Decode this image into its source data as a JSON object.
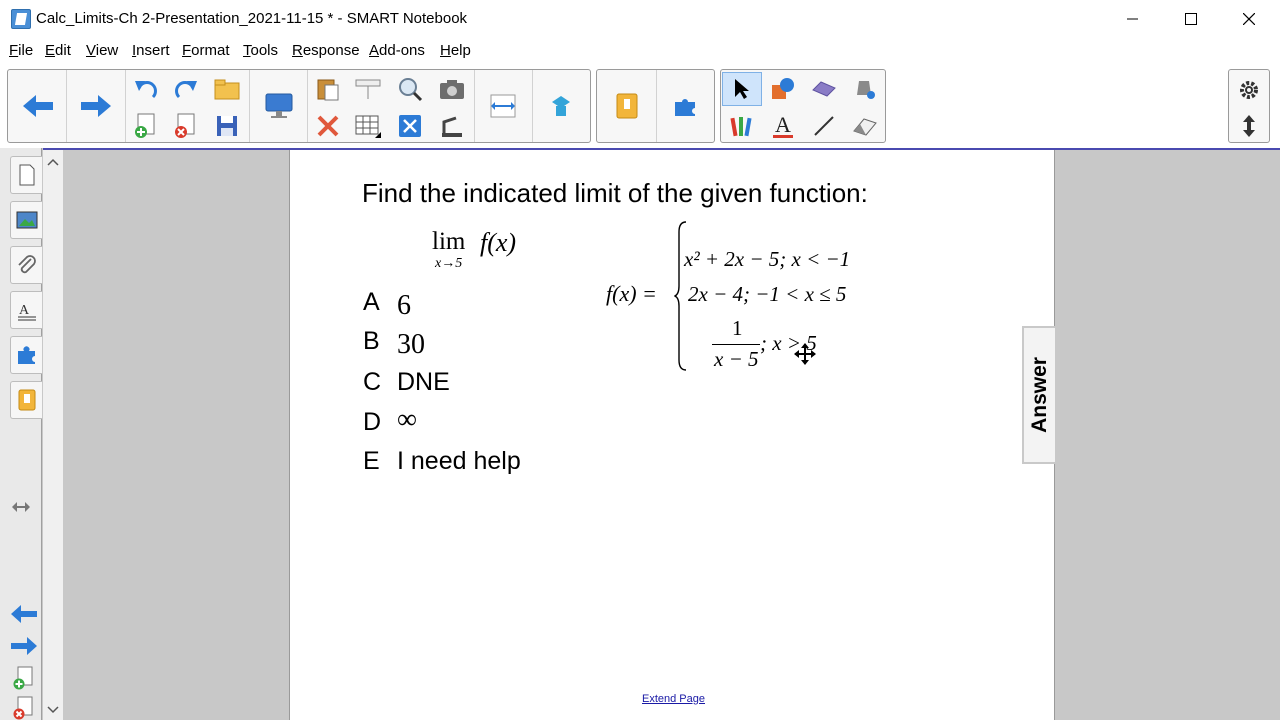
{
  "window": {
    "title": "Calc_Limits-Ch 2-Presentation_2021-11-15 * - SMART Notebook"
  },
  "menu": {
    "items": [
      {
        "label": "File",
        "underline": "F"
      },
      {
        "label": "Edit",
        "underline": "E"
      },
      {
        "label": "View",
        "underline": "V"
      },
      {
        "label": "Insert",
        "underline": "I"
      },
      {
        "label": "Format",
        "underline": "F"
      },
      {
        "label": "Tools",
        "underline": "T"
      },
      {
        "label": "Response",
        "underline": "R"
      },
      {
        "label": "Add-ons",
        "underline": "A"
      },
      {
        "label": "Help",
        "underline": "H"
      }
    ]
  },
  "toolbar": {
    "icons": [
      "back-arrow-icon",
      "forward-arrow-icon",
      "undo-icon",
      "redo-icon",
      "open-folder-icon",
      "add-page-icon",
      "delete-page-icon",
      "save-icon",
      "screen-shade-icon",
      "paste-icon",
      "delete-icon",
      "show-pointer-icon",
      "table-icon",
      "magnifier-icon",
      "clear-icon",
      "camera-icon",
      "full-screen-icon",
      "dual-page-icon",
      "response-icon",
      "gallery-icon",
      "add-ons-icon",
      "select-icon",
      "shapes-icon",
      "eraser-shape-icon",
      "fill-icon",
      "pens-icon",
      "text-icon",
      "line-icon",
      "eraser-icon",
      "settings-icon",
      "toolbar-position-icon"
    ]
  },
  "colors": {
    "accent": "#2c7bd6",
    "select_highlight": "#cfe4fb",
    "workspace": "#c8c8c8",
    "link": "#1a1aa6"
  },
  "page": {
    "question": "Find the indicated limit of the given function:",
    "limit": {
      "lim": "lim",
      "sub": "x→5",
      "expr": "f(x)"
    },
    "function": {
      "lhs": "f(x) =",
      "case1": "x² + 2x − 5; x < −1",
      "case2": "2x − 4; −1 < x ≤ 5",
      "case3_num": "1",
      "case3_den": "x − 5",
      "case3_cond": "; x > 5"
    },
    "options": [
      {
        "letter": "A",
        "text": "6"
      },
      {
        "letter": "B",
        "text": "30"
      },
      {
        "letter": "C",
        "text": "DNE"
      },
      {
        "letter": "D",
        "text": "∞"
      },
      {
        "letter": "E",
        "text": "I need help"
      }
    ],
    "answer_tab": "Answer",
    "extend_link": "Extend Page"
  }
}
